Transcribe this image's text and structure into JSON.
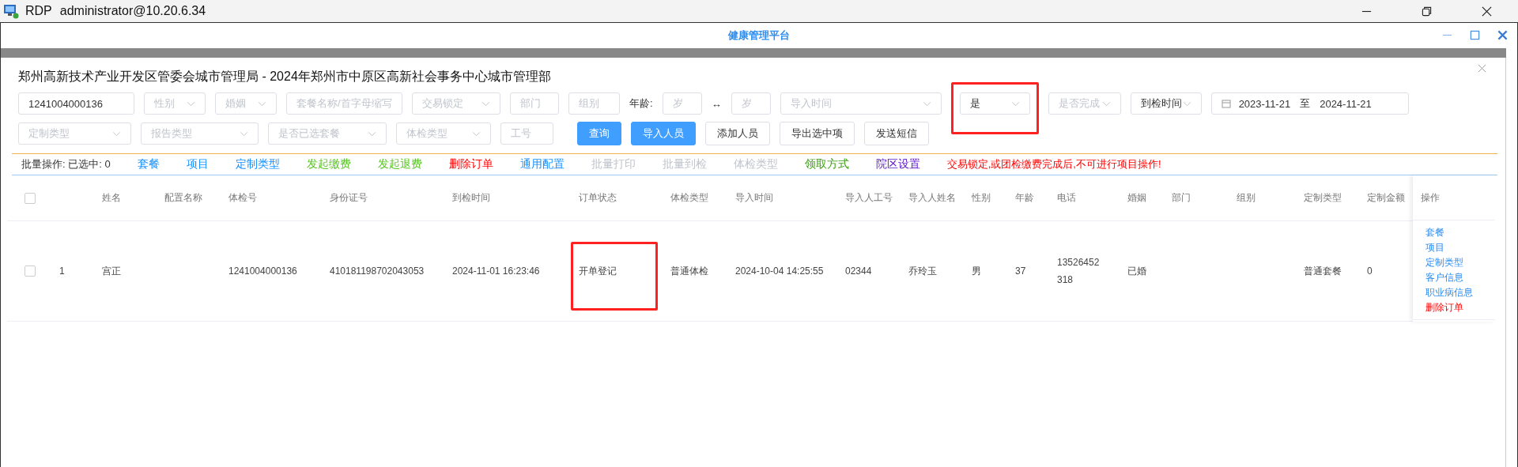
{
  "rdp_window": {
    "app": "RDP",
    "title": "administrator@10.20.6.34"
  },
  "app_window": {
    "title": "健康管理平台"
  },
  "dialog": {
    "title": "郑州高新技术产业开发区管委会城市管理局 - 2024年郑州市中原区高新社会事务中心城市管理部",
    "filters_row_1": [
      {
        "kind": "input",
        "value": "1241004000136",
        "highlighted": false
      },
      {
        "kind": "select",
        "placeholder": "性别",
        "highlighted": false
      },
      {
        "kind": "select",
        "placeholder": "婚姻",
        "highlighted": false
      },
      {
        "kind": "input",
        "placeholder": "套餐名称/首字母缩写",
        "highlighted": false
      },
      {
        "kind": "select",
        "placeholder": "交易锁定",
        "highlighted": false
      },
      {
        "kind": "input",
        "placeholder": "部门",
        "highlighted": false
      },
      {
        "kind": "input",
        "placeholder": "组别",
        "highlighted": false
      },
      {
        "kind": "age",
        "label": "年龄:",
        "from_placeholder": "岁",
        "separator": "↔",
        "to_placeholder": "岁",
        "highlighted": false
      },
      {
        "kind": "select",
        "placeholder": "导入时间",
        "highlighted": false
      },
      {
        "kind": "select",
        "value": "是",
        "highlighted": true
      },
      {
        "kind": "select",
        "placeholder": "是否完成",
        "highlighted": false
      },
      {
        "kind": "select",
        "value": "到检时间",
        "highlighted": false
      },
      {
        "kind": "daterange",
        "from": "2023-11-21",
        "separator": "至",
        "to": "2024-11-21",
        "highlighted": false
      }
    ],
    "filters_row_2": [
      {
        "kind": "select",
        "placeholder": "定制类型",
        "highlighted": false
      },
      {
        "kind": "select",
        "placeholder": "报告类型",
        "highlighted": false
      },
      {
        "kind": "select",
        "placeholder": "是否已选套餐",
        "highlighted": false
      },
      {
        "kind": "select",
        "placeholder": "体检类型",
        "highlighted": false
      },
      {
        "kind": "input",
        "placeholder": "工号",
        "highlighted": false
      }
    ],
    "buttons": [
      {
        "label": "查询",
        "primary": true
      },
      {
        "label": "导入人员",
        "primary": true
      },
      {
        "label": "添加人员",
        "primary": false
      },
      {
        "label": "导出选中项",
        "primary": false
      },
      {
        "label": "发送短信",
        "primary": false
      }
    ],
    "batch_label": "批量操作: 已选中: 0",
    "batch_actions": [
      {
        "label": "套餐",
        "color": "#1890ff"
      },
      {
        "label": "项目",
        "color": "#1890ff"
      },
      {
        "label": "定制类型",
        "color": "#1890ff"
      },
      {
        "label": "发起缴费",
        "color": "#52c41a"
      },
      {
        "label": "发起退费",
        "color": "#52c41a"
      },
      {
        "label": "删除订单",
        "color": "#ff0000"
      },
      {
        "label": "通用配置",
        "color": "#1890ff"
      },
      {
        "label": "批量打印",
        "color": "#c0c4cc"
      },
      {
        "label": "批量到检",
        "color": "#c0c4cc"
      },
      {
        "label": "体检类型",
        "color": "#c0c4cc"
      },
      {
        "label": "领取方式",
        "color": "#389e0d"
      },
      {
        "label": "院区设置",
        "color": "#5b16c8"
      }
    ],
    "batch_warning": "交易锁定,或团检缴费完成后,不可进行项目操作!",
    "table": {
      "select_all_checked": false,
      "columns": [
        {
          "kind": "index"
        },
        {
          "kind": "text",
          "label": "姓名"
        },
        {
          "kind": "text",
          "label": "配置名称"
        },
        {
          "kind": "text",
          "label": "体检号"
        },
        {
          "kind": "text",
          "label": "身份证号"
        },
        {
          "kind": "text",
          "label": "到检时间"
        },
        {
          "kind": "text",
          "label": "订单状态"
        },
        {
          "kind": "text",
          "label": "体检类型"
        },
        {
          "kind": "text",
          "label": "导入时间"
        },
        {
          "kind": "text",
          "label": "导入人工号"
        },
        {
          "kind": "text",
          "label": "导入人姓名"
        },
        {
          "kind": "text",
          "label": "性别"
        },
        {
          "kind": "text",
          "label": "年龄"
        },
        {
          "kind": "text",
          "label": "电话"
        },
        {
          "kind": "text",
          "label": "婚姻"
        },
        {
          "kind": "text",
          "label": "部门"
        },
        {
          "kind": "text",
          "label": "组别"
        },
        {
          "kind": "text",
          "label": "定制类型"
        },
        {
          "kind": "text",
          "label": "定制金额"
        }
      ],
      "actions_column": "操作",
      "rows": [
        {
          "checked": false,
          "cells": [
            {
              "text": "1",
              "highlighted": false
            },
            {
              "text": "宫正",
              "highlighted": false
            },
            {
              "highlighted": false
            },
            {
              "text": "1241004000136",
              "highlighted": false
            },
            {
              "text": "410181198702043053",
              "highlighted": false
            },
            {
              "text": "2024-11-01 16:23:46",
              "highlighted": false
            },
            {
              "text": "开单登记",
              "highlighted": true
            },
            {
              "text": "普通体检",
              "highlighted": false
            },
            {
              "text": "2024-10-04 14:25:55",
              "highlighted": false
            },
            {
              "text": "02344",
              "highlighted": false
            },
            {
              "text": "乔玲玉",
              "highlighted": false
            },
            {
              "text": "男",
              "highlighted": false
            },
            {
              "text": "37",
              "highlighted": false
            },
            {
              "text": "13526452318",
              "highlighted": false
            },
            {
              "text": "已婚",
              "highlighted": false
            },
            {
              "highlighted": false
            },
            {
              "highlighted": false
            },
            {
              "text": "普通套餐",
              "highlighted": false
            },
            {
              "text": "0",
              "highlighted": false
            }
          ],
          "actions": [
            {
              "label": "套餐",
              "danger": false
            },
            {
              "label": "项目",
              "danger": false
            },
            {
              "label": "定制类型",
              "danger": false
            },
            {
              "label": "客户信息",
              "danger": false
            },
            {
              "label": "职业病信息",
              "danger": false
            },
            {
              "label": "删除订单",
              "danger": true
            }
          ]
        }
      ]
    }
  }
}
